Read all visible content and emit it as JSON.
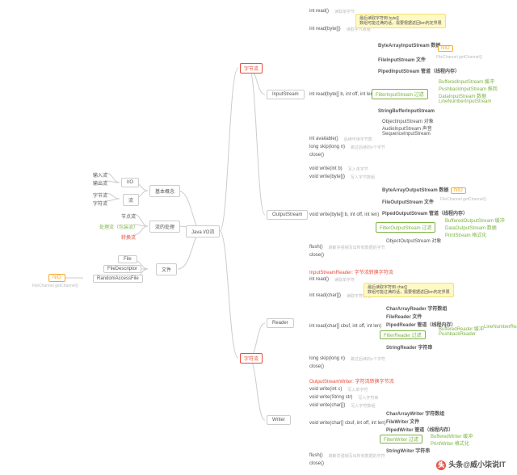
{
  "root": "Java I/O流",
  "groups": {
    "basic": "基本概念",
    "handle": "流的处理",
    "file": "文件",
    "byte": "字节流",
    "char": "字符流"
  },
  "l1": {
    "io": "I/O",
    "stream": "流"
  },
  "io_sub": {
    "in": "输入流",
    "out": "输出流"
  },
  "stream_sub": {
    "b": "字节流",
    "c": "字符流"
  },
  "handle_sub": {
    "node": "节点流",
    "proc": "处理流（包装流）",
    "conv": "转换流"
  },
  "file_sub": {
    "f": "File",
    "fd": "FileDescriptor",
    "raf": "RandomAccessFile"
  },
  "nio": "NIO",
  "nio_sub": "FileChannel getChannel()",
  "classes": {
    "is": "InputStream",
    "os": "OutputStream",
    "rd": "Reader",
    "wr": "Writer"
  },
  "in": {
    "m1": "int read()",
    "m1t": "读取单字节",
    "m2": "int read(byte[])",
    "m2t": "读取字节数组",
    "m3": "int read(byte[] b, int off, int len)",
    "m4": "int available()",
    "m4t": "后续可读字节数",
    "m5": "long skip(long n)",
    "m5t": "跳过后续的n个字节",
    "m6": "close()",
    "sub": {
      "ba": "ByteArrayInputStream 数据",
      "fi": "FileInputStream 文件",
      "pi": "PipedInputStream 管道（线程内存）",
      "fil": "FilterInputStream 过滤",
      "sbi": "StringBufferInputStream",
      "oi": "ObjectInputStream 对象",
      "ai": "AudioInputStream 声音",
      "si": "SequenceInputStream"
    },
    "filter": {
      "buf": "BufferedInputStream 缓冲",
      "push": "PushbackInputStream 推回",
      "data": "DataInputStream 数据",
      "line": "LineNumberInputStream"
    }
  },
  "out": {
    "m1": "void write(int b)",
    "m1t": "写入单字节",
    "m2": "void write(byte[])",
    "m2t": "写入字节数组",
    "m3": "void write(byte[] b, int off, int len)",
    "m4": "flush()",
    "m4t": "跳断并强制写出所有数据的字节",
    "m5": "close()",
    "sub": {
      "ba": "ByteArrayOutputStream 数据",
      "fo": "FileOutputStream 文件",
      "po": "PipedOutputStream 管道（线程内存）",
      "fil": "FilterOutputStream 过滤",
      "oo": "ObjectOutputStream 对象"
    },
    "filter": {
      "buf": "BufferedOutputStream 缓冲",
      "data": "DataOutputStream 数据",
      "ps": "PrintStream 格式化"
    }
  },
  "rd": {
    "hdr": "InputStreamReader: 字节流转换字符流",
    "m1": "int read()",
    "m1t": "读取单字符",
    "m2": "int read(char[])",
    "m2t": "读取字符数组",
    "m3": "int read(char[] cbuf, int off, int len)",
    "m5": "long skip(long n)",
    "m5t": "跳过后续的n个字符",
    "m6": "close()",
    "sub": {
      "ca": "CharArrayReader 字符数组",
      "fr": "FileReader 文件",
      "pr": "PipedReader 管道（线程内存）",
      "fil": "FilterReader 过滤",
      "sr": "StringReader 字符串"
    },
    "filter": {
      "buf": "BufferedReader 缓冲",
      "push": "PushbackReader",
      "line": "LineNumberReader"
    }
  },
  "wr": {
    "hdr": "OutputStreamWriter: 字符流转换字节流",
    "m1": "void write(int c)",
    "m1t": "写入单字符",
    "m2": "void write(String str)",
    "m2t": "写入字符串",
    "m3": "void write(char[])",
    "m3t": "写入字符数组",
    "m4": "void write(char[] cbuf, int off, int len)",
    "m5": "flush()",
    "m5t": "跳断并强制写出所有数据的字符",
    "m6": "close()",
    "sub": {
      "ca": "CharArrayWriter 字符数组",
      "fw": "FileWriter 文件",
      "pw": "PipedWriter 管道（线程内存）",
      "fil": "FilterWriter 过滤",
      "sw": "StringWriter 字符串"
    },
    "filter": {
      "buf": "BufferedWriter 缓冲",
      "print": "PrintWriter 格式化"
    }
  },
  "note": {
    "l1": "最后读取字符到 byte[]",
    "l2": "数组可能过满的话，需要根据返回len判定界限"
  },
  "note_rd": {
    "l1": "最后读取字符到 char[]",
    "l2": "数组可能过满的话，需要根据返回len判定界限"
  },
  "wm": "头条@威小柒说IT"
}
